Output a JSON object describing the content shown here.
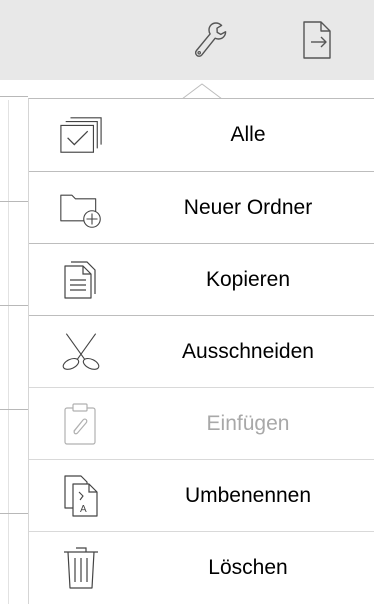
{
  "toolbar": {
    "tools_icon": "wrench-icon",
    "export_icon": "export-document-icon"
  },
  "colors": {
    "toolbar_bg": "#e8e8e8",
    "icon_stroke": "#444444",
    "disabled_text": "#a8a8a8",
    "separator": "#bdbdbd"
  },
  "menu": {
    "items": [
      {
        "label": "Alle",
        "icon": "select-all-icon",
        "enabled": true
      },
      {
        "label": "Neuer Ordner",
        "icon": "new-folder-icon",
        "enabled": true
      },
      {
        "label": "Kopieren",
        "icon": "copy-icon",
        "enabled": true
      },
      {
        "label": "Ausschneiden",
        "icon": "scissors-icon",
        "enabled": true
      },
      {
        "label": "Einfügen",
        "icon": "paste-icon",
        "enabled": false
      },
      {
        "label": "Umbenennen",
        "icon": "rename-icon",
        "enabled": true
      },
      {
        "label": "Löschen",
        "icon": "trash-icon",
        "enabled": true
      }
    ]
  }
}
